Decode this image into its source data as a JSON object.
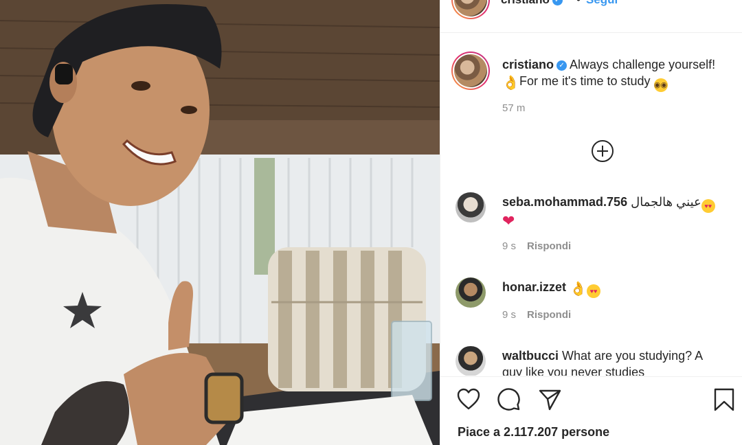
{
  "header": {
    "username": "cristiano",
    "separator": "•",
    "follow_label": "Segui",
    "more_label": "•••"
  },
  "caption": {
    "username": "cristiano",
    "text_line1": "Always challenge yourself!",
    "text_line2": "For me it's time to study",
    "time": "57 m"
  },
  "comments": [
    {
      "username": "seba.mohammad.756",
      "text": "عيني هالجمال",
      "time": "9 s",
      "reply_label": "Rispondi"
    },
    {
      "username": "honar.izzet",
      "text": "",
      "time": "9 s",
      "reply_label": "Rispondi"
    },
    {
      "username": "waltbucci",
      "text": "What are you studying? A",
      "text_cont": "guy like you never studies",
      "time": "",
      "reply_label": ""
    }
  ],
  "actions": {
    "like_icon": "heart-icon",
    "comment_icon": "comment-icon",
    "share_icon": "share-icon",
    "save_icon": "bookmark-icon",
    "likes_text": "Piace a 2.117.207 persone"
  },
  "colors": {
    "accent": "#3897f0",
    "text": "#262626",
    "muted": "#8e8e8e",
    "border": "#efefef"
  }
}
